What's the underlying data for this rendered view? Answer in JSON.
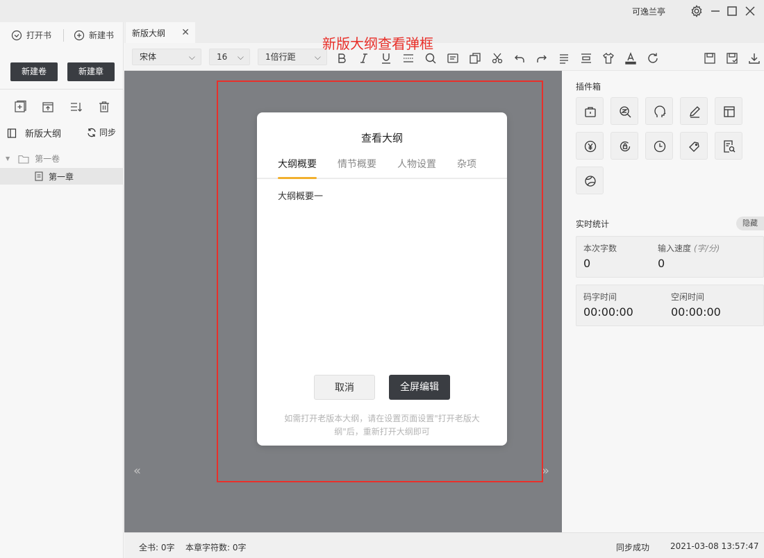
{
  "titlebar": {
    "user": "可逸兰亭",
    "icons": [
      "gear-icon",
      "minimize-icon",
      "maximize-icon",
      "close-icon"
    ]
  },
  "sidebar": {
    "open_book": "打开书",
    "new_book": "新建书",
    "new_volume": "新建卷",
    "new_chapter": "新建章",
    "tool_icons": [
      "add-chapter-icon",
      "import-icon",
      "sort-icon",
      "trash-icon"
    ],
    "outline_label": "新版大纲",
    "sync_label": "同步",
    "tree": {
      "volume": "第一卷",
      "chapter": "第一章"
    }
  },
  "tabbar": {
    "tab_label": "新版大纲"
  },
  "toolbar": {
    "font": "宋体",
    "size": "16",
    "spacing": "1倍行距",
    "icons": [
      "bold-icon",
      "italic-icon",
      "underline-icon",
      "strikethrough-icon",
      "search-icon",
      "note-icon",
      "copy-icon",
      "cut-icon",
      "undo-icon",
      "redo-icon",
      "align-icon",
      "indent-icon",
      "shirt-icon",
      "text-color-icon",
      "refresh-icon",
      "save-icon",
      "save-as-icon",
      "download-icon"
    ]
  },
  "annotation": {
    "label": "新版大纲查看弹框"
  },
  "dialog": {
    "title": "查看大纲",
    "tabs": [
      "大纲概要",
      "情节概要",
      "人物设置",
      "杂项"
    ],
    "active_tab": 0,
    "body": "大纲概要一",
    "cancel": "取消",
    "fullscreen_edit": "全屏编辑",
    "tip": "如需打开老版本大纲，请在设置页面设置\"打开老版大纲\"后，重新打开大纲即可"
  },
  "right_panel": {
    "plugins_title": "插件箱",
    "plugin_icons": [
      "bag-icon",
      "zoom-search-icon",
      "head-icon",
      "pencil-icon",
      "layout-icon",
      "yen-icon",
      "lock-cycle-icon",
      "clock-icon",
      "tag-icon",
      "doc-search-icon",
      "planet-icon"
    ],
    "stats_title": "实时统计",
    "hide_label": "隐藏",
    "stats": {
      "count_label": "本次字数",
      "count_value": "0",
      "speed_label": "输入速度",
      "speed_unit": "(字/分)",
      "speed_value": "0",
      "typing_time_label": "码字时间",
      "typing_time_value": "00:00:00",
      "idle_time_label": "空闲时间",
      "idle_time_value": "00:00:00"
    }
  },
  "statusbar": {
    "total": "全书: 0字",
    "chapter_count": "本章字符数: 0字",
    "sync_status": "同步成功",
    "datetime": "2021-03-08 13:57:47"
  }
}
